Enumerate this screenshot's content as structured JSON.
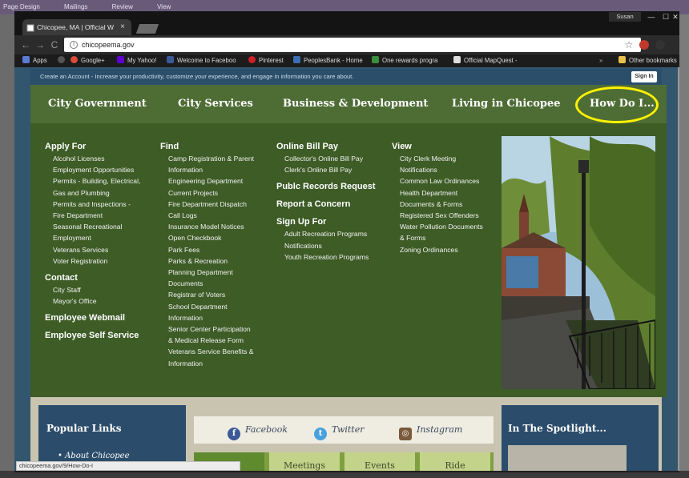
{
  "word_ribbon": [
    "Page Design",
    "Mailings",
    "Review",
    "View"
  ],
  "window": {
    "user": "Susan",
    "controls": [
      "—",
      "☐",
      "✕"
    ]
  },
  "tab": {
    "title": "Chicopee, MA | Official W",
    "close": "×"
  },
  "address": {
    "url": "chicopeema.gov"
  },
  "nav_glyphs": {
    "back": "←",
    "forward": "→",
    "reload": "C",
    "info": "i",
    "star": "☆"
  },
  "bookmarks": [
    {
      "label": "Apps",
      "color": "#5a7bd6"
    },
    {
      "label": "Google+",
      "color": "#dd4b39"
    },
    {
      "label": "My Yahoo!",
      "color": "#6001d2"
    },
    {
      "label": "Welcome to Faceboo",
      "color": "#3b5998"
    },
    {
      "label": "Pinterest",
      "color": "#cb2027"
    },
    {
      "label": "PeoplesBank - Home",
      "color": "#3a6fb0"
    },
    {
      "label": "One rewards progra",
      "color": "#3a8f3a"
    },
    {
      "label": "Official MapQuest -",
      "color": "#dddddd"
    }
  ],
  "other_bookmarks": "Other bookmarks",
  "topstrip": {
    "text": "Create an Account - Increase your productivity, customize your experience, and engage in information you care about.",
    "signin": "Sign In"
  },
  "mainnav": [
    "City Government",
    "City Services",
    "Business & Development",
    "Living in Chicopee",
    "How Do I..."
  ],
  "highlight_color": "#fff200",
  "menu": {
    "apply_for": {
      "heading": "Apply For",
      "items": [
        "Alcohol Licenses",
        "Employment Opportunities",
        "Permits - Building, Electrical,",
        "Gas and Plumbing",
        "Permits and Inspections -",
        "Fire Department",
        "Seasonal Recreational",
        "Employment",
        "Veterans Services",
        "Voter Registration"
      ]
    },
    "contact": {
      "heading": "Contact",
      "items": [
        "City Staff",
        "Mayor's Office"
      ]
    },
    "employee_webmail": "Employee Webmail",
    "employee_self_service": "Employee Self Service",
    "find": {
      "heading": "Find",
      "items": [
        "Camp Registration & Parent",
        "Information",
        "Engineering Department",
        "Current Projects",
        "Fire Department Dispatch",
        "Call Logs",
        "Insurance Model Notices",
        "Open Checkbook",
        "Park Fees",
        "Parks & Recreation",
        "Planning Department",
        "Documents",
        "Registrar of Voters",
        "School Department",
        "Information",
        "Senior Center Participation",
        "& Medical Release Form",
        "Veterans Service Benefits &",
        "Information"
      ]
    },
    "online_bill_pay": {
      "heading": "Online Bill Pay",
      "items": [
        "Collector's Online Bill Pay",
        "Clerk's Online Bill Pay"
      ]
    },
    "public_records": "Publc Records Request",
    "report_concern": "Report a Concern",
    "sign_up_for": {
      "heading": "Sign Up For",
      "items": [
        "Adult Recreation Programs",
        "Notifications",
        "Youth Recreation Programs"
      ]
    },
    "view": {
      "heading": "View",
      "items": [
        "City Clerk Meeting",
        "Notifications",
        "Common Law Ordinances",
        "Health Department",
        "Documents & Forms",
        "Registered Sex Offenders",
        "Water Pollution Documents",
        "& Forms",
        "Zoning Ordinances"
      ]
    }
  },
  "lower": {
    "popular_title": "Popular Links",
    "popular_item": "About Chicopee",
    "social": [
      {
        "label": "Facebook",
        "glyph": "f",
        "color": "#3b5998"
      },
      {
        "label": "Twitter",
        "glyph": "t",
        "color": "#4aa0dc"
      },
      {
        "label": "Instagram",
        "glyph": "◎",
        "color": "#7a5a3a"
      }
    ],
    "tiles": [
      "",
      "Meetings",
      "Events",
      "Ride"
    ],
    "spot_title": "In The Spotlight..."
  },
  "status_url": "chicopeema.gov/9/How-Do-I"
}
